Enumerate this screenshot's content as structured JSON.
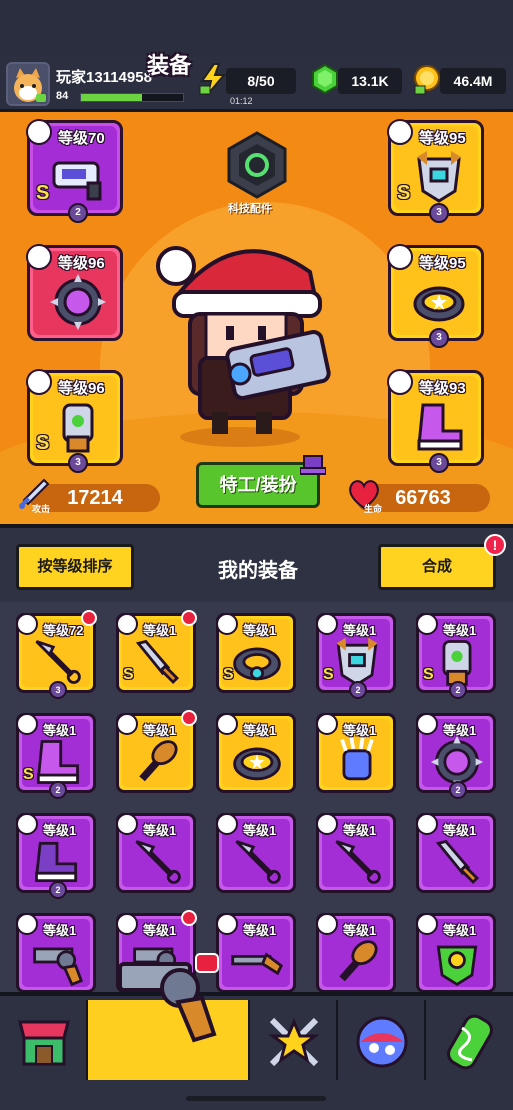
{
  "player": {
    "name": "玩家13114958",
    "level": "84",
    "xp_fraction": 0.6
  },
  "resources": {
    "energy": "8/50",
    "energy_timer": "01:12",
    "gems": "13.1K",
    "coins": "46.4M"
  },
  "stage": {
    "tech_label": "科技配件",
    "agent_button": "特工/装扮",
    "attack_label": "攻击",
    "attack_value": "17214",
    "hp_label": "生命",
    "hp_value": "66763"
  },
  "equipped": [
    {
      "slot": "weapon",
      "level": "等级70",
      "rarity": "purple",
      "grade": "S",
      "stars": "2",
      "icon": "blaster-icon"
    },
    {
      "slot": "necklace",
      "level": "等级96",
      "rarity": "red",
      "grade": "",
      "stars": "",
      "icon": "spiked-collar-icon"
    },
    {
      "slot": "glove",
      "level": "等级96",
      "rarity": "gold",
      "grade": "S",
      "stars": "3",
      "icon": "power-gauntlet-icon"
    },
    {
      "slot": "armor",
      "level": "等级95",
      "rarity": "gold",
      "grade": "S",
      "stars": "3",
      "icon": "robot-armor-icon"
    },
    {
      "slot": "ring",
      "level": "等级95",
      "rarity": "gold",
      "grade": "",
      "stars": "3",
      "icon": "star-ring-icon"
    },
    {
      "slot": "boots",
      "level": "等级93",
      "rarity": "gold",
      "grade": "",
      "stars": "3",
      "icon": "boots-icon"
    }
  ],
  "list": {
    "sort_button": "按等级排序",
    "title": "我的装备",
    "merge_button": "合成",
    "merge_alert": "!"
  },
  "inventory": [
    {
      "level": "等级72",
      "rarity": "gold",
      "grade": "",
      "stars": "3",
      "icon": "kunai-icon",
      "new": true
    },
    {
      "level": "等级1",
      "rarity": "gold",
      "grade": "S",
      "stars": "",
      "icon": "sword-icon",
      "new": true
    },
    {
      "level": "等级1",
      "rarity": "gold",
      "grade": "S",
      "stars": "",
      "icon": "ring-icon",
      "new": false
    },
    {
      "level": "等级1",
      "rarity": "purple",
      "grade": "S",
      "stars": "2",
      "icon": "robot-armor-icon",
      "new": false
    },
    {
      "level": "等级1",
      "rarity": "purple",
      "grade": "S",
      "stars": "2",
      "icon": "power-gauntlet-icon",
      "new": false
    },
    {
      "level": "等级1",
      "rarity": "purple",
      "grade": "S",
      "stars": "2",
      "icon": "boots-icon",
      "new": false
    },
    {
      "level": "等级1",
      "rarity": "gold",
      "grade": "",
      "stars": "",
      "icon": "club-icon",
      "new": true
    },
    {
      "level": "等级1",
      "rarity": "gold",
      "grade": "",
      "stars": "",
      "icon": "star-ring-icon",
      "new": false
    },
    {
      "level": "等级1",
      "rarity": "gold",
      "grade": "",
      "stars": "",
      "icon": "claw-glove-icon",
      "new": false
    },
    {
      "level": "等级1",
      "rarity": "purple",
      "grade": "",
      "stars": "2",
      "icon": "spiked-collar-icon",
      "new": false
    },
    {
      "level": "等级1",
      "rarity": "purple",
      "grade": "",
      "stars": "2",
      "icon": "sneaker-icon",
      "new": false
    },
    {
      "level": "等级1",
      "rarity": "purple",
      "grade": "",
      "stars": "",
      "icon": "kunai-icon",
      "new": false
    },
    {
      "level": "等级1",
      "rarity": "purple",
      "grade": "",
      "stars": "",
      "icon": "kunai-icon",
      "new": false
    },
    {
      "level": "等级1",
      "rarity": "purple",
      "grade": "",
      "stars": "",
      "icon": "kunai-icon",
      "new": false
    },
    {
      "level": "等级1",
      "rarity": "purple",
      "grade": "",
      "stars": "",
      "icon": "sword-icon",
      "new": false
    },
    {
      "level": "等级1",
      "rarity": "purple",
      "grade": "",
      "stars": "",
      "icon": "revolver-icon",
      "new": false
    },
    {
      "level": "等级1",
      "rarity": "purple",
      "grade": "",
      "stars": "",
      "icon": "revolver-icon",
      "new": true
    },
    {
      "level": "等级1",
      "rarity": "purple",
      "grade": "",
      "stars": "",
      "icon": "shotgun-icon",
      "new": false
    },
    {
      "level": "等级1",
      "rarity": "purple",
      "grade": "",
      "stars": "",
      "icon": "club-icon",
      "new": false
    },
    {
      "level": "等级1",
      "rarity": "purple",
      "grade": "",
      "stars": "",
      "icon": "plant-armor-icon",
      "new": false
    }
  ],
  "nav": {
    "items": [
      "shop-icon",
      "equipment-icon",
      "crossed-swords-star-icon",
      "ball-icon",
      "dna-capsule-icon"
    ],
    "active_label": "装备"
  },
  "colors": {
    "stage": "#f28a14",
    "gold": "#ffd21c",
    "purple": "#a42ed5",
    "red": "#e8375f",
    "green": "#58c52c"
  }
}
